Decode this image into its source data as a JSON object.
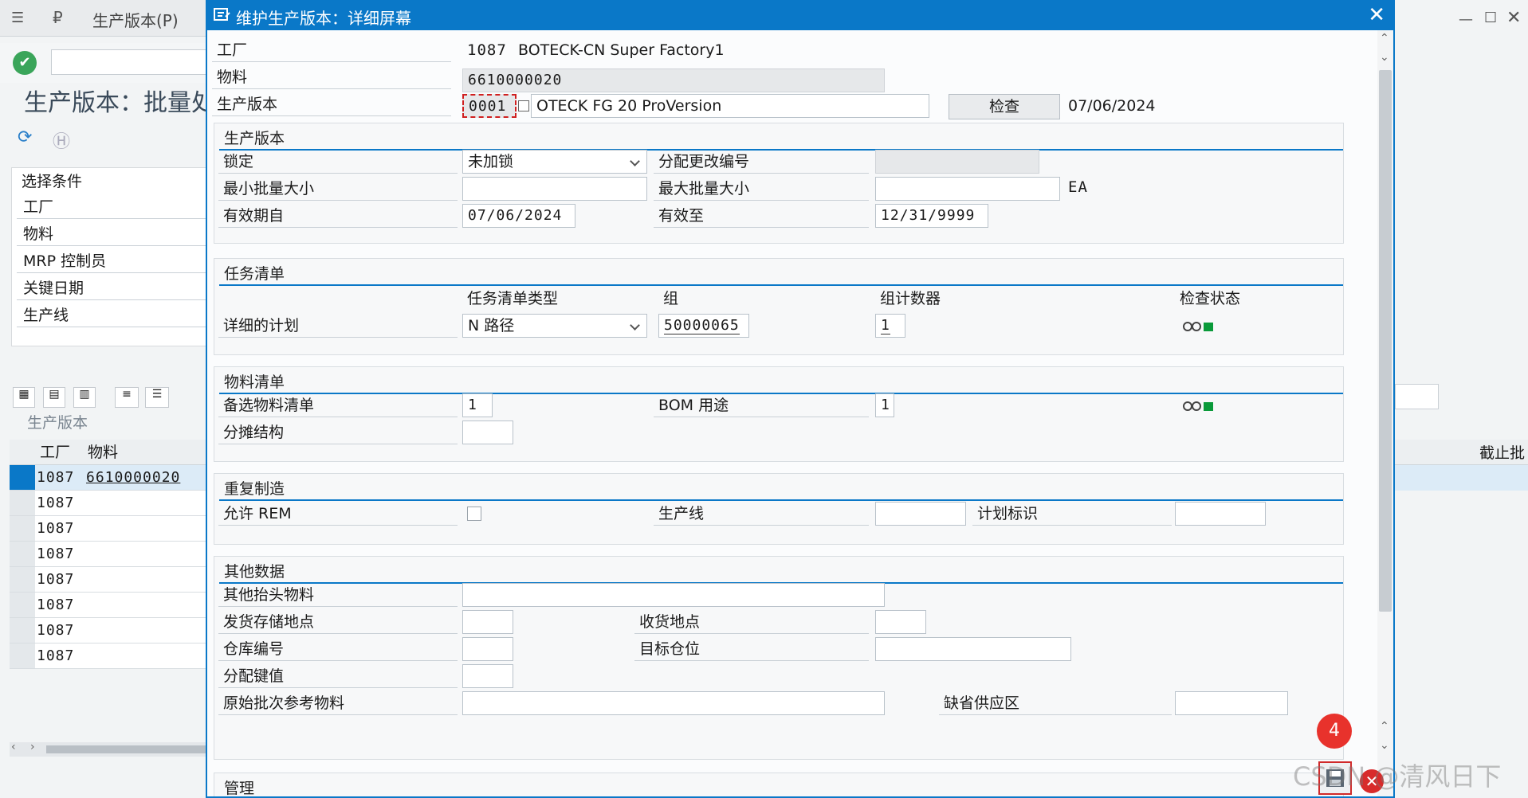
{
  "background": {
    "menu_title": "生产版本(P)",
    "page_title": "生产版本：批量处",
    "selection_header": "选择条件",
    "selection_fields": [
      "工厂",
      "物料",
      "MRP 控制员",
      "关键日期",
      "生产线"
    ],
    "table_title": "生产版本",
    "table_columns": [
      "工厂",
      "物料"
    ],
    "right_column_header": "截止批",
    "rows": [
      {
        "plant": "1087",
        "material": "6610000020"
      },
      {
        "plant": "1087",
        "material": ""
      },
      {
        "plant": "1087",
        "material": ""
      },
      {
        "plant": "1087",
        "material": ""
      },
      {
        "plant": "1087",
        "material": ""
      },
      {
        "plant": "1087",
        "material": ""
      },
      {
        "plant": "1087",
        "material": ""
      },
      {
        "plant": "1087",
        "material": ""
      }
    ]
  },
  "dialog": {
    "title": "维护生产版本：详细屏幕",
    "plant_label": "工厂",
    "plant_value": "1087",
    "plant_name": "BOTECK-CN Super Factory1",
    "material_label": "物料",
    "material_value": "6610000020",
    "version_label": "生产版本",
    "version_value": "0001",
    "version_text": "OTECK FG 20 ProVersion",
    "check_button": "检查",
    "check_date": "07/06/2024",
    "group_production": {
      "title": "生产版本",
      "lock_label": "锁定",
      "lock_value": "未加锁",
      "change_no_label": "分配更改编号",
      "min_lot_label": "最小批量大小",
      "max_lot_label": "最大批量大小",
      "unit": "EA",
      "valid_from_label": "有效期自",
      "valid_from": "07/06/2024",
      "valid_to_label": "有效至",
      "valid_to": "12/31/9999"
    },
    "group_tasklist": {
      "title": "任务清单",
      "col_type": "任务清单类型",
      "col_group": "组",
      "col_counter": "组计数器",
      "col_status": "检查状态",
      "row_label": "详细的计划",
      "type_value": "N 路径",
      "group_value": "50000065",
      "counter_value": "1"
    },
    "group_bom": {
      "title": "物料清单",
      "alt_bom_label": "备选物料清单",
      "alt_bom_value": "1",
      "bom_usage_label": "BOM 用途",
      "bom_usage_value": "1",
      "apportion_label": "分摊结构"
    },
    "group_rem": {
      "title": "重复制造",
      "allow_rem_label": "允许 REM",
      "prod_line_label": "生产线",
      "plan_id_label": "计划标识"
    },
    "group_other": {
      "title": "其他数据",
      "other_header_label": "其他抬头物料",
      "issue_sloc_label": "发货存储地点",
      "receiving_label": "收货地点",
      "warehouse_label": "仓库编号",
      "dest_bin_label": "目标仓位",
      "dist_key_label": "分配键值",
      "orig_batch_label": "原始批次参考物料",
      "supply_area_label": "缺省供应区"
    },
    "group_admin": {
      "title": "管理"
    },
    "step_badge": "4"
  },
  "watermark": "CSDN @清风日下",
  "colors": {
    "accent": "#0a78c8",
    "status_green": "#0a9a3a",
    "badge_red": "#e8322c"
  }
}
